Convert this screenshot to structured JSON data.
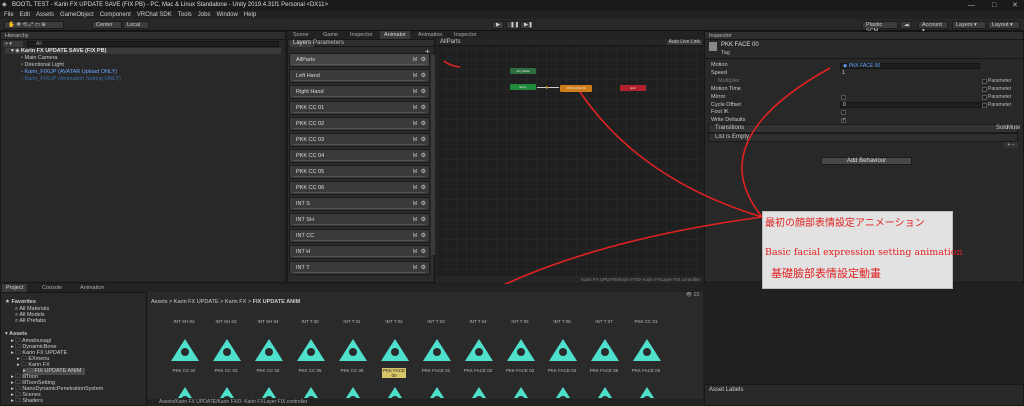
{
  "window": {
    "title": "BOOTL TEST - Karin FX UPDATE SAVE (FIX PB) - PC, Mac & Linux Standalone - Unity 2019.4.31f1 Personal <DX11>",
    "min": "—",
    "max": "□",
    "close": "✕"
  },
  "menu": [
    "File",
    "Edit",
    "Assets",
    "GameObject",
    "Component",
    "VRChat SDK",
    "Tools",
    "Jobs",
    "Window",
    "Help"
  ],
  "toolbar": {
    "center": "Center",
    "local": "Local",
    "plastic": "Plastic SCM",
    "account": "Account",
    "layers": "Layers",
    "layout": "Layout"
  },
  "hierarchy": {
    "tab": "Hierarchy",
    "add": "+ ▾",
    "search_placeholder": "All",
    "items": [
      {
        "label": "Karin FX UPDATE SAVE (FIX PB)",
        "indent": 0,
        "color": "#e0e0e0",
        "bold": true
      },
      {
        "label": "Main Camera",
        "indent": 2,
        "color": "#cccccc"
      },
      {
        "label": "Directional Light",
        "indent": 2,
        "color": "#cccccc"
      },
      {
        "label": "Karin_FIXUP (AVATAR Upload ONLY)",
        "indent": 2,
        "color": "#6aa8ff"
      },
      {
        "label": "Karin_FIXUP (Animation Setting ONLY)",
        "indent": 2,
        "color": "#3f6ea8"
      }
    ]
  },
  "center_tabs": [
    "Scene",
    "Game",
    "Inspector",
    "Animator",
    "Animation",
    "Inspector"
  ],
  "animator": {
    "layers_tab": "Layers",
    "params_tab": "Parameters",
    "breadcrumb": "AllParts",
    "auto_live": "Auto Live Link",
    "footer": "Karin FX UPDATE/Karin FX/0- Karin FXLayer FIX.controller",
    "layers": [
      "AllParts",
      "Left Hand",
      "Right Hand",
      "PKK CC 01",
      "PKK CC 02",
      "PKK CC 03",
      "PKK CC 04",
      "PKK CC 05",
      "PKK CC 06",
      "INT S",
      "INT SH",
      "INT CC",
      "INT H",
      "INT T"
    ],
    "m_label": "M",
    "gear": "⚙",
    "nodes": {
      "entry": "Entry",
      "any": "Any State",
      "state": "PKK FACE 00",
      "exit": "Exit"
    }
  },
  "inspector": {
    "tab": "Inspector",
    "name": "PKK FACE 00",
    "tag": "Tag",
    "rows": [
      {
        "label": "Motion",
        "value": "◉ PKK FACE 00",
        "kind": "field",
        "color": "#6aa8ff"
      },
      {
        "label": "Speed",
        "value": "1",
        "kind": "plain"
      },
      {
        "label": "Multiplier",
        "kind": "param",
        "param": "Parameter",
        "dim": true
      },
      {
        "label": "Motion Time",
        "kind": "param",
        "param": "Parameter"
      },
      {
        "label": "Mirror",
        "kind": "check",
        "on": false,
        "param": "Parameter"
      },
      {
        "label": "Cycle Offset",
        "value": "0",
        "kind": "field",
        "param": "Parameter"
      },
      {
        "label": "Foot IK",
        "kind": "check",
        "on": false
      },
      {
        "label": "Write Defaults",
        "kind": "check",
        "on": true
      }
    ],
    "transitions": "Transitions",
    "solo": "Solo",
    "mute": "Mute",
    "list_empty": "List is Empty",
    "plus_minus": "+ −",
    "add_behaviour": "Add Behaviour",
    "asset_labels": "Asset Labels"
  },
  "annotation": {
    "jp": "最初の顔部表情設定アニメーション",
    "en": "Basic facial expression setting animation",
    "zh": "基礎臉部表情設定動畫",
    "color": "#e02222"
  },
  "project": {
    "tabs": [
      "Project",
      "Console",
      "Animation"
    ],
    "favorites": "Favorites",
    "fav_items": [
      "All Materials",
      "All Models",
      "All Prefabs"
    ],
    "assets": "Assets",
    "tree": [
      {
        "label": "Amatousagi",
        "indent": 1
      },
      {
        "label": "DynamicBone",
        "indent": 1
      },
      {
        "label": "Karin FX UPDATE",
        "indent": 1
      },
      {
        "label": "EXmenu",
        "indent": 2
      },
      {
        "label": "Karin FX",
        "indent": 2
      },
      {
        "label": "FIX UPDATE ANIM",
        "indent": 3,
        "selected": true
      },
      {
        "label": "lilToon",
        "indent": 1
      },
      {
        "label": "lilToonSetting",
        "indent": 1
      },
      {
        "label": "NanoDynamicPenetrationSystem",
        "indent": 1
      },
      {
        "label": "Scenes",
        "indent": 1
      },
      {
        "label": "Shaders",
        "indent": 1
      }
    ],
    "breadcrumb": [
      "Assets",
      "Karin FX UPDATE",
      "Karin FX",
      "FIX UPDATE ANIM"
    ],
    "footer": "Assets/Karin FX UPDATE/Karin FX/0- Karin FXLayer FIX.controller",
    "count": "13",
    "top_labels": [
      "INT SH 02",
      "INT SH 03",
      "INT SH 04",
      "INT T 00",
      "INT T 01",
      "INT T 02",
      "INT T 03",
      "INT T 04",
      "INT T 05",
      "INT T 06",
      "INT T 07",
      "PKK CC 01"
    ],
    "mid_labels": [
      "PKK CC 02",
      "PKK CC 03",
      "PKK CC 04",
      "PKK CC 05",
      "PKK CC 06",
      "PKK FACE 00",
      "PKK FACE 01",
      "PKK FACE 02",
      "PKK FACE 03",
      "PKK FACE 04",
      "PKK FACE 05",
      "PKK FACE 06"
    ]
  }
}
